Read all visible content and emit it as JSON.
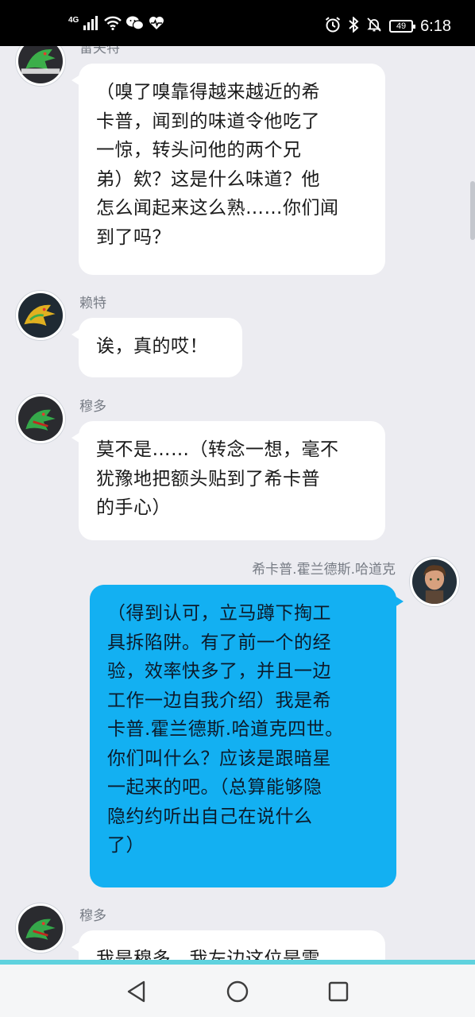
{
  "status_bar": {
    "network": "4G",
    "battery": "49",
    "time": "6:18",
    "icons": [
      "signal-icon",
      "wifi-icon",
      "wechat-icon",
      "health-icon",
      "alarm-icon",
      "bluetooth-icon",
      "mute-icon",
      "battery-icon"
    ]
  },
  "messages": [
    {
      "sender": "雷夫特",
      "side": "left",
      "lines": [
        "（嗅了嗅靠得越来越近的希",
        "卡普，闻到的味道令他吃了",
        "一惊，转头问他的两个兄",
        "弟）欸？这是什么味道？他",
        "怎么闻起来这么熟……你们闻",
        "到了吗？"
      ]
    },
    {
      "sender": "赖特",
      "side": "left",
      "lines": [
        "诶，真的哎！"
      ]
    },
    {
      "sender": "穆多",
      "side": "left",
      "lines": [
        "莫不是……（转念一想，毫不",
        "犹豫地把额头贴到了希卡普",
        "的手心）"
      ]
    },
    {
      "sender": "希卡普.霍兰德斯.哈道克",
      "side": "right",
      "lines": [
        "（得到认可，立马蹲下掏工",
        "具拆陷阱。有了前一个的经",
        "验，效率快多了，并且一边",
        "工作一边自我介绍）我是希",
        "卡普.霍兰德斯.哈道克四世。",
        "你们叫什么？应该是跟暗星",
        "一起来的吧。（总算能够隐",
        "隐约约听出自己在说什么",
        "了）"
      ]
    },
    {
      "sender": "穆多",
      "side": "left",
      "lines": [
        "我是穆多，我左边这位是雷"
      ]
    }
  ],
  "colors": {
    "background": "#ececf1",
    "incoming_bubble": "#ffffff",
    "outgoing_bubble": "#13b0f2",
    "nav_accent": "#5fd2de"
  },
  "nav": {
    "buttons": [
      "back-icon",
      "home-icon",
      "recents-icon"
    ]
  }
}
